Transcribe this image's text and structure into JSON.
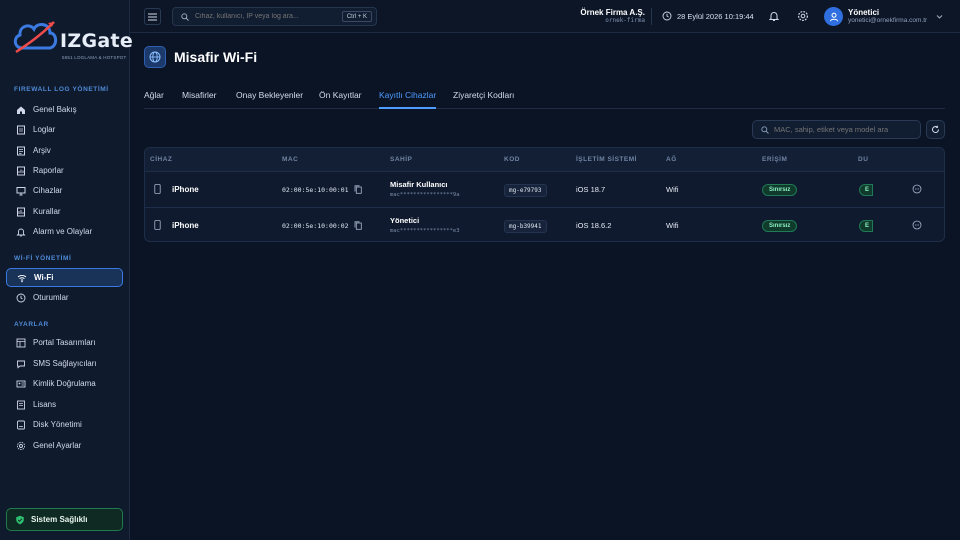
{
  "brand": {
    "name": "IZGate",
    "tagline": "5651 LOGLAMA & HOTSPOT",
    "accent": "#3b7ae0"
  },
  "sidebar": {
    "sections": [
      {
        "title": "FIREWALL LOG YÖNETİMİ",
        "items": [
          {
            "label": "Genel Bakış",
            "icon": "home-icon"
          },
          {
            "label": "Loglar",
            "icon": "document-icon"
          },
          {
            "label": "Arşiv",
            "icon": "archive-icon"
          },
          {
            "label": "Raporlar",
            "icon": "report-icon"
          },
          {
            "label": "Cihazlar",
            "icon": "monitor-icon"
          },
          {
            "label": "Kurallar",
            "icon": "rules-icon"
          },
          {
            "label": "Alarm ve Olaylar",
            "icon": "bell-icon"
          }
        ]
      },
      {
        "title": "Wİ-Fİ YÖNETİMİ",
        "items": [
          {
            "label": "Wi-Fi",
            "icon": "wifi-icon",
            "active": true
          },
          {
            "label": "Oturumlar",
            "icon": "clock-icon"
          }
        ]
      },
      {
        "title": "AYARLAR",
        "items": [
          {
            "label": "Portal Tasarımları",
            "icon": "layout-icon"
          },
          {
            "label": "SMS Sağlayıcıları",
            "icon": "chat-icon"
          },
          {
            "label": "Kimlik Doğrulama",
            "icon": "id-card-icon"
          },
          {
            "label": "Lisans",
            "icon": "license-icon"
          },
          {
            "label": "Disk Yönetimi",
            "icon": "disk-icon"
          },
          {
            "label": "Genel Ayarlar",
            "icon": "gear-icon"
          }
        ]
      }
    ],
    "health_label": "Sistem Sağlıklı"
  },
  "topbar": {
    "search_placeholder": "Cihaz, kullanıcı, IP veya log ara...",
    "search_shortcut": "Ctrl + K",
    "company_name": "Örnek Firma A.Ş.",
    "company_slug": "ornek-firma",
    "datetime": "28 Eylül 2026 10:19:44",
    "user_name": "Yönetici",
    "user_email": "yonetici@ornekfirma.com.tr"
  },
  "page": {
    "title": "Misafir Wi-Fi",
    "tabs": [
      {
        "label": "Ağlar"
      },
      {
        "label": "Misafirler"
      },
      {
        "label": "Onay Bekleyenler"
      },
      {
        "label": "Ön Kayıtlar"
      },
      {
        "label": "Kayıtlı Cihazlar",
        "active": true
      },
      {
        "label": "Ziyaretçi Kodları"
      }
    ],
    "table_search_placeholder": "MAC, sahip, etiket veya model ara"
  },
  "table": {
    "columns": [
      "CİHAZ",
      "MAC",
      "SAHİP",
      "KOD",
      "İŞLETİM SİSTEMİ",
      "AĞ",
      "ERİŞİM",
      "DU"
    ],
    "rows": [
      {
        "device": "iPhone",
        "mac": "02:00:5e:10:00:01",
        "owner": "Misafir Kullanıcı",
        "owner_sub": "mac****************9a",
        "code": "mg-e79793",
        "os": "iOS 18.7",
        "network": "Wifi",
        "access": "Sınırsız",
        "status": "E"
      },
      {
        "device": "iPhone",
        "mac": "02:00:5e:10:00:02",
        "owner": "Yönetici",
        "owner_sub": "mac****************e3",
        "code": "mg-b39941",
        "os": "iOS 18.6.2",
        "network": "Wifi",
        "access": "Sınırsız",
        "status": "E"
      }
    ]
  }
}
